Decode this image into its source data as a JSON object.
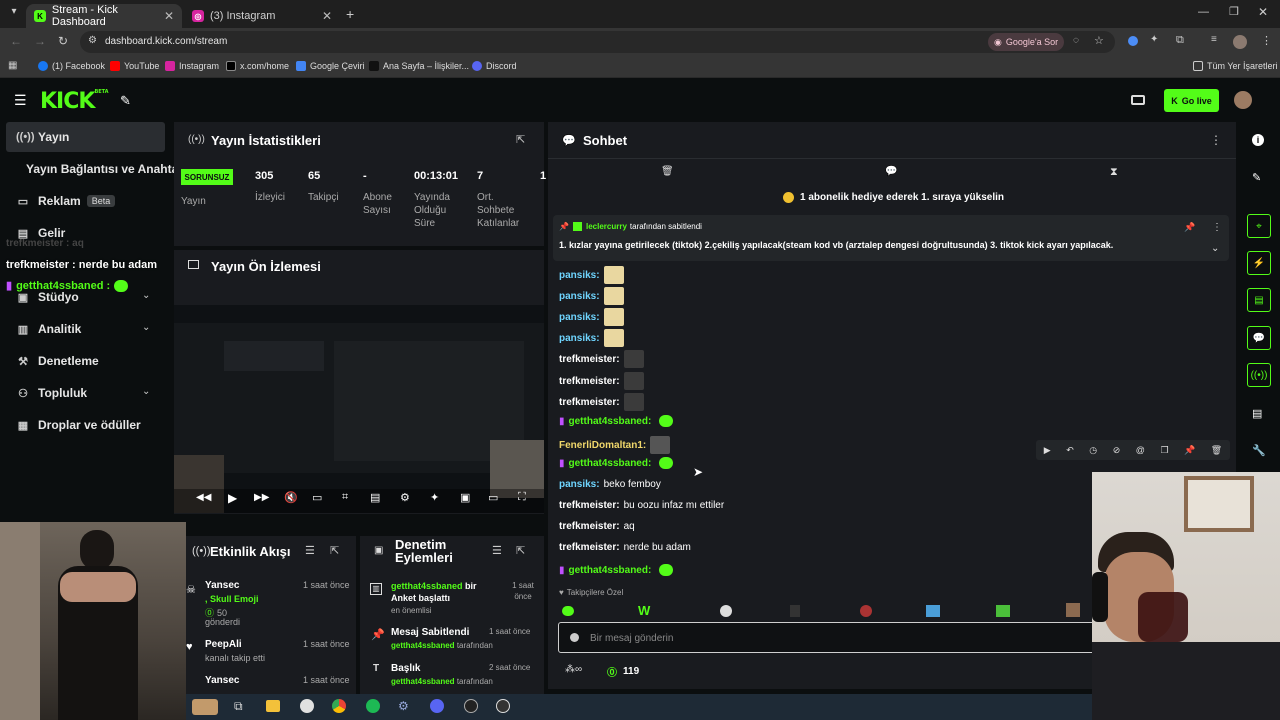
{
  "browser": {
    "tabs": [
      {
        "label": "Stream - Kick Dashboard",
        "active": true
      },
      {
        "label": "(3) Instagram",
        "active": false
      }
    ],
    "url": "dashboard.kick.com/stream",
    "google_btn": "Google'a Sor",
    "bookmarks": [
      "(1) Facebook",
      "YouTube",
      "Instagram",
      "x.com/home",
      "Google Çeviri",
      "Ana Sayfa – İlişkiler...",
      "Discord"
    ],
    "all_bookmarks": "Tüm Yer İşaretleri"
  },
  "header": {
    "logo": "KICK",
    "logo_beta": "BETA",
    "go_live": "Go live"
  },
  "sidebar": {
    "items": [
      {
        "label": "Yayın",
        "icon": "broadcast-icon"
      },
      {
        "label": "Yayın Bağlantısı ve Anahtarı",
        "icon": ""
      },
      {
        "label": "Reklam",
        "icon": "ad-icon",
        "badge": "Beta"
      },
      {
        "label": "Gelir",
        "icon": "money-icon"
      },
      {
        "label": "Stüdyo",
        "icon": "studio-icon"
      },
      {
        "label": "Analitik",
        "icon": "chart-icon"
      },
      {
        "label": "Denetleme",
        "icon": "hammer-icon"
      },
      {
        "label": "Topluluk",
        "icon": "users-icon"
      },
      {
        "label": "Droplar ve ödüller",
        "icon": "gift-icon"
      }
    ]
  },
  "overlay": {
    "line1": "trefkmeister : aq",
    "line2": "trefkmeister : nerde bu adam",
    "line3_user": "getthat4ssbaned :"
  },
  "stats": {
    "title": "Yayın İstatistikleri",
    "status": "SORUNSUZ",
    "status_label": "Yayın",
    "viewers": "305",
    "viewers_label": "İzleyici",
    "followers": "65",
    "followers_label": "Takipçi",
    "subs": "-",
    "subs_label": "Abone Sayısı",
    "duration": "00:13:01",
    "duration_label": "Yayında Olduğu Süre",
    "chatters": "7",
    "chatters_label": "Ort. Sohbete Katılanlar",
    "extra": "1"
  },
  "preview": {
    "title": "Yayın Ön İzlemesi"
  },
  "activity": {
    "title": "Etkinlik Akışı",
    "items": [
      {
        "user": "Yansec",
        "time": "1 saat önce",
        "detail": ", Skull Emoji",
        "amount": "50",
        "action": "gönderdi"
      },
      {
        "user": "PeepAli",
        "time": "1 saat önce",
        "detail": "kanalı takip etti"
      },
      {
        "user": "Yansec",
        "time": "1 saat önce",
        "detail": ""
      }
    ]
  },
  "moderation": {
    "title": "Denetim Eylemleri",
    "items": [
      {
        "user": "getthat4ssbaned",
        "text": "bir Anket başlattı",
        "time": "1 saat önce",
        "sub": "en önemlisi"
      },
      {
        "title": "Mesaj Sabitlendi",
        "time": "1 saat önce",
        "user": "getthat4ssbaned",
        "sub": "tarafından"
      },
      {
        "title": "Başlık",
        "time": "2 saat önce",
        "user": "getthat4ssbaned",
        "sub": "tarafından"
      }
    ]
  },
  "chat": {
    "title": "Sohbet",
    "banner": "1 abonelik hediye ederek 1. sıraya yükselin",
    "pinned_by": "leclercurry",
    "pinned_by_suffix": "tarafından sabitlendi",
    "pinned_text": "1. kızlar yayına getirilecek (tiktok) 2.çekiliş yapılacak(steam kod vb (arztalep dengesi doğrultusunda) 3. tiktok kick ayarı yapılacak.",
    "messages": [
      {
        "user": "pansiks:",
        "color": "#6fd5ff",
        "text": "",
        "emote": "#e9d7a0"
      },
      {
        "user": "pansiks:",
        "color": "#6fd5ff",
        "text": "",
        "emote": "#e9d7a0"
      },
      {
        "user": "pansiks:",
        "color": "#6fd5ff",
        "text": "",
        "emote": "#e9d7a0"
      },
      {
        "user": "pansiks:",
        "color": "#6fd5ff",
        "text": "",
        "emote": "#e9d7a0"
      },
      {
        "user": "trefkmeister:",
        "color": "#ffffff",
        "text": "",
        "emote": "#3b3b3b"
      },
      {
        "user": "trefkmeister:",
        "color": "#ffffff",
        "text": "",
        "emote": "#3b3b3b"
      },
      {
        "user": "trefkmeister:",
        "color": "#ffffff",
        "text": "",
        "emote": "#3b3b3b"
      },
      {
        "user": "getthat4ssbaned:",
        "color": "#53fc18",
        "text": "",
        "kick": true
      },
      {
        "user": "FenerliDomaltan1:",
        "color": "#f0d76b",
        "text": "",
        "emote": "#555555"
      },
      {
        "user": "getthat4ssbaned:",
        "color": "#53fc18",
        "text": "",
        "kick": true
      },
      {
        "user": "pansiks:",
        "color": "#6fd5ff",
        "text": "beko femboy"
      },
      {
        "user": "trefkmeister:",
        "color": "#ffffff",
        "text": "bu oozu infaz mı ettiler"
      },
      {
        "user": "trefkmeister:",
        "color": "#ffffff",
        "text": "aq"
      },
      {
        "user": "trefkmeister:",
        "color": "#ffffff",
        "text": "nerde bu adam"
      },
      {
        "user": "getthat4ssbaned:",
        "color": "#53fc18",
        "text": "",
        "kick": true
      }
    ],
    "followers_only": "Takipçilere Özel",
    "input_placeholder": "Bir mesaj gönderin",
    "points": "119"
  }
}
